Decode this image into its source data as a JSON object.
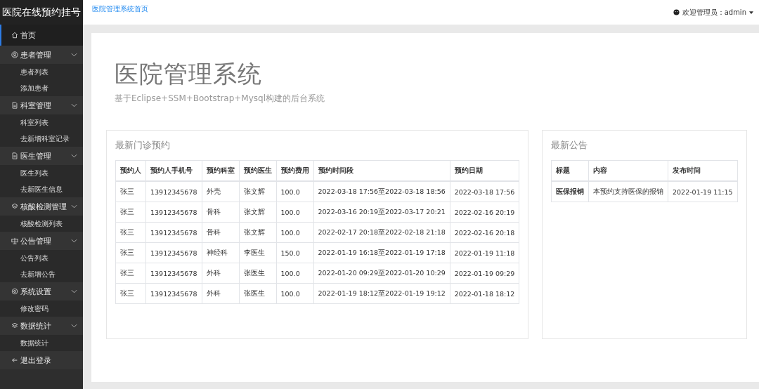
{
  "sidebar": {
    "brand": "医院在线预约挂号",
    "items": [
      {
        "kind": "link",
        "label": "首页",
        "selected": true
      },
      {
        "kind": "group",
        "label": "患者管理",
        "expanded": true,
        "children": [
          {
            "label": "患者列表"
          },
          {
            "label": "添加患者"
          }
        ]
      },
      {
        "kind": "group",
        "label": "科室管理",
        "expanded": true,
        "children": [
          {
            "label": "科室列表"
          },
          {
            "label": "去新增科室记录"
          }
        ]
      },
      {
        "kind": "group",
        "label": "医生管理",
        "expanded": true,
        "children": [
          {
            "label": "医生列表"
          },
          {
            "label": "去新医生信息"
          }
        ]
      },
      {
        "kind": "group",
        "label": "核酸检测管理",
        "expanded": true,
        "children": [
          {
            "label": "核酸检测列表"
          }
        ]
      },
      {
        "kind": "group",
        "label": "公告管理",
        "expanded": true,
        "children": [
          {
            "label": "公告列表"
          },
          {
            "label": "去新增公告"
          }
        ]
      },
      {
        "kind": "group",
        "label": "系统设置",
        "expanded": true,
        "children": [
          {
            "label": "修改密码"
          }
        ]
      },
      {
        "kind": "group",
        "label": "数据统计",
        "expanded": true,
        "children": [
          {
            "label": "数据统计"
          }
        ]
      },
      {
        "kind": "link",
        "label": "退出登录",
        "selected": false
      }
    ]
  },
  "header": {
    "breadcrumb": "医院管理系统首页",
    "user": "欢迎管理员：admin"
  },
  "hero": {
    "title": "医院管理系统",
    "subtitle": "基于Eclipse+SSM+Bootstrap+Mysql构建的后台系统"
  },
  "appointments": {
    "title": "最新门诊预约",
    "columns": [
      "预约人",
      "预约人手机号",
      "预约科室",
      "预约医生",
      "预约费用",
      "预约时间段",
      "预约日期"
    ],
    "rows": [
      [
        "张三",
        "13912345678",
        "外壳",
        "张文辉",
        "100.0",
        "2022-03-18 17:56至2022-03-18 18:56",
        "2022-03-18 17:56"
      ],
      [
        "张三",
        "13912345678",
        "骨科",
        "张文辉",
        "100.0",
        "2022-03-16 20:19至2022-03-17 20:21",
        "2022-02-16 20:19"
      ],
      [
        "张三",
        "13912345678",
        "骨科",
        "张文辉",
        "100.0",
        "2022-02-17 20:18至2022-02-18 21:18",
        "2022-02-16 20:18"
      ],
      [
        "张三",
        "13912345678",
        "神经科",
        "李医生",
        "150.0",
        "2022-01-19 16:18至2022-01-19 17:18",
        "2022-01-19 11:18"
      ],
      [
        "张三",
        "13912345678",
        "外科",
        "张医生",
        "100.0",
        "2022-01-20 09:29至2022-01-20 10:29",
        "2022-01-19 09:29"
      ],
      [
        "张三",
        "13912345678",
        "外科",
        "张医生",
        "100.0",
        "2022-01-19 18:12至2022-01-19 19:12",
        "2022-01-18 18:12"
      ]
    ]
  },
  "notices": {
    "title": "最新公告",
    "columns": [
      "标题",
      "内容",
      "发布时间"
    ],
    "rows": [
      [
        "医保报销",
        "本预约支持医保的报销",
        "2022-01-19 11:15"
      ]
    ]
  }
}
